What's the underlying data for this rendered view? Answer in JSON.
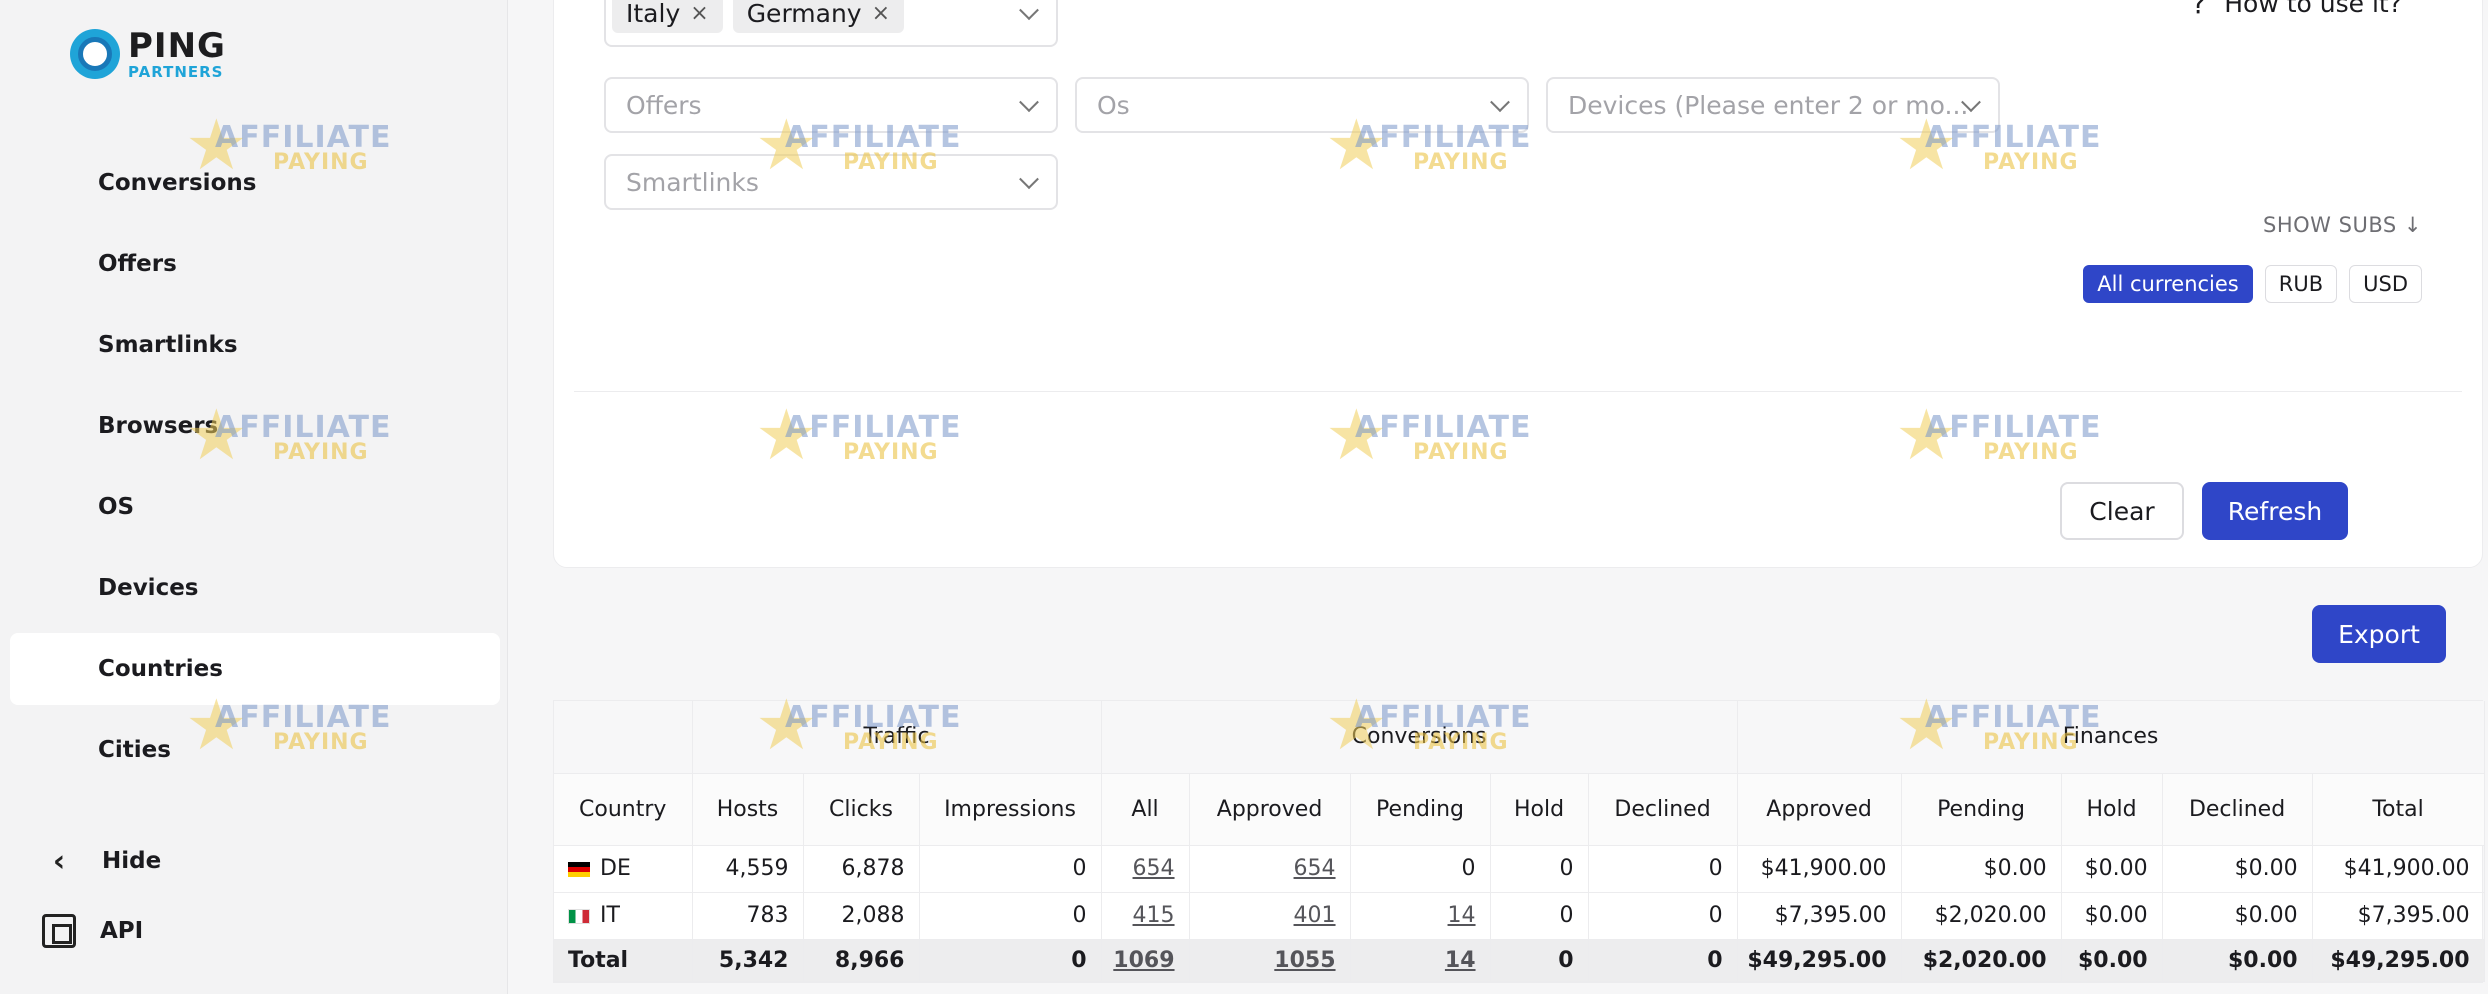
{
  "brand": {
    "title": "PING",
    "subtitle": "PARTNERS"
  },
  "sidebar": {
    "items": [
      {
        "label": "Conversions",
        "active": false
      },
      {
        "label": "Offers",
        "active": false
      },
      {
        "label": "Smartlinks",
        "active": false
      },
      {
        "label": "Browsers",
        "active": false
      },
      {
        "label": "OS",
        "active": false
      },
      {
        "label": "Devices",
        "active": false
      },
      {
        "label": "Countries",
        "active": true
      },
      {
        "label": "Cities",
        "active": false
      }
    ],
    "hide_label": "Hide",
    "api_label": "API"
  },
  "filters": {
    "country_tags": [
      "Italy",
      "Germany"
    ],
    "offers_placeholder": "Offers",
    "os_placeholder": "Os",
    "devices_placeholder": "Devices (Please enter 2 or mo...",
    "smartlinks_placeholder": "Smartlinks",
    "help_label": "How to use it?",
    "show_subs_label": "SHOW SUBS",
    "currencies": [
      "All currencies",
      "RUB",
      "USD"
    ],
    "active_currency": "All currencies",
    "clear_label": "Clear",
    "refresh_label": "Refresh"
  },
  "export_label": "Export",
  "table": {
    "groups": [
      "Traffic",
      "Conversions",
      "Finances"
    ],
    "columns": [
      "Country",
      "Hosts",
      "Clicks",
      "Impressions",
      "All",
      "Approved",
      "Pending",
      "Hold",
      "Declined",
      "Approved",
      "Pending",
      "Hold",
      "Declined",
      "Total"
    ],
    "rows": [
      {
        "country": "DE",
        "hosts": "4,559",
        "clicks": "6,878",
        "impressions": "0",
        "all": "654",
        "approved": "654",
        "pending": "0",
        "hold": "0",
        "declined": "0",
        "fin_approved": "$41,900.00",
        "fin_pending": "$0.00",
        "fin_hold": "$0.00",
        "fin_declined": "$0.00",
        "fin_total": "$41,900.00"
      },
      {
        "country": "IT",
        "hosts": "783",
        "clicks": "2,088",
        "impressions": "0",
        "all": "415",
        "approved": "401",
        "pending": "14",
        "hold": "0",
        "declined": "0",
        "fin_approved": "$7,395.00",
        "fin_pending": "$2,020.00",
        "fin_hold": "$0.00",
        "fin_declined": "$0.00",
        "fin_total": "$7,395.00"
      }
    ],
    "total": {
      "label": "Total",
      "hosts": "5,342",
      "clicks": "8,966",
      "impressions": "0",
      "all": "1069",
      "approved": "1055",
      "pending": "14",
      "hold": "0",
      "declined": "0",
      "fin_approved": "$49,295.00",
      "fin_pending": "$2,020.00",
      "fin_hold": "$0.00",
      "fin_declined": "$0.00",
      "fin_total": "$49,295.00"
    }
  },
  "watermark": {
    "line1": "AFFILIATE",
    "line2": "PAYING"
  },
  "colors": {
    "primary": "#2f46c8",
    "sidebar_bg": "#f3f3f4",
    "page_bg": "#f6f6f7"
  }
}
